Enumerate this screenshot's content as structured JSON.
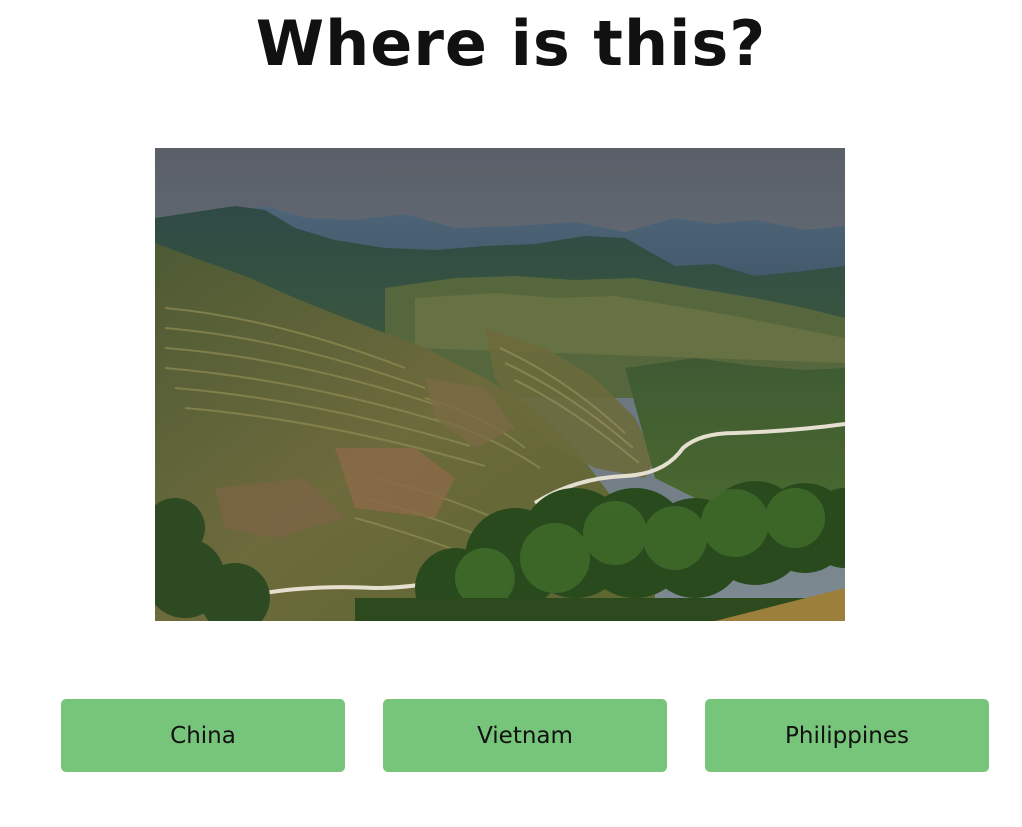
{
  "quiz": {
    "question": "Where is this?",
    "photo": {
      "subject": "terraced rice fields on mountain slopes with winding road"
    },
    "answers": [
      {
        "label": "China"
      },
      {
        "label": "Vietnam"
      },
      {
        "label": "Philippines"
      }
    ],
    "colors": {
      "button_bg": "#77c57a",
      "text": "#111111",
      "background": "#ffffff"
    }
  }
}
